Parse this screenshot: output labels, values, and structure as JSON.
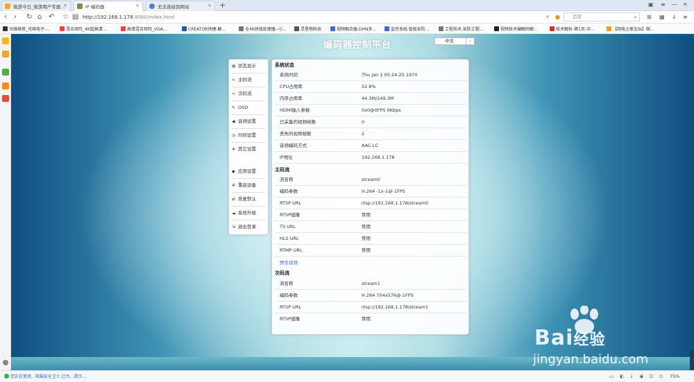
{
  "browser": {
    "tabs": [
      {
        "label": "微游今日_微游用户专属..."
      },
      {
        "label": "IP 编码器"
      },
      {
        "label": "无法连接到网站"
      }
    ],
    "new_tab": "+",
    "url_host": "http://192.168.1.178",
    "url_path": ":8080/index.html",
    "search_placeholder": "百度",
    "zoom": "75%",
    "bookmarks": [
      {
        "label": "讯维维修_讯维电子-..."
      },
      {
        "label": "混合矩阵_4K超高清..."
      },
      {
        "label": "高清混合矩阵_VGA..."
      },
      {
        "label": "CREATOR快捷-解..."
      },
      {
        "label": "全4K拼接处理器--小..."
      },
      {
        "label": "灵星雨科技"
      },
      {
        "label": "视频融合器,DHN多..."
      },
      {
        "label": "监控系统,智能安防..."
      },
      {
        "label": "工程技术,安防工程..."
      },
      {
        "label": "视频技术编解码解..."
      },
      {
        "label": "技术解析-第1页-中..."
      },
      {
        "label": "【网电之家论坛】图..."
      }
    ],
    "status_message": "您正在使用...电脑安全卫士:已为...提示..."
  },
  "app": {
    "title": "编码器控制平台",
    "language": "中文"
  },
  "sidebar": {
    "items": [
      {
        "label": "状态显示",
        "icon": "doc-icon"
      },
      {
        "label": "主码流",
        "icon": "share-icon"
      },
      {
        "label": "次码流",
        "icon": "share-icon"
      },
      {
        "label": "OSD",
        "icon": "pencil-icon"
      },
      {
        "label": "音频设置",
        "icon": "volume-icon"
      },
      {
        "label": "时间设置",
        "icon": "clock-icon"
      },
      {
        "label": "其它设置",
        "icon": "gear-icon"
      },
      {
        "label": "应用设置",
        "icon": "app-icon"
      },
      {
        "label": "重启设备",
        "icon": "gear-icon"
      },
      {
        "label": "恢复默认",
        "icon": "shuffle-icon"
      },
      {
        "label": "系统升级",
        "icon": "cloud-icon"
      },
      {
        "label": "退出登录",
        "icon": "logout-icon"
      }
    ]
  },
  "status": {
    "system_heading": "系统状态",
    "system_rows": [
      {
        "key": "系统时间",
        "value": "Thu Jan 1 05:24:25 1970"
      },
      {
        "key": "CPU占用率",
        "value": "52.8%"
      },
      {
        "key": "内存占用率",
        "value": "44.3M/249.3M"
      },
      {
        "key": "HDMI输入参数",
        "value": "0x0@0FPS 0Kbps"
      },
      {
        "key": "已采集的视频帧数",
        "value": "0"
      },
      {
        "key": "丢失的视频帧数",
        "value": "2"
      },
      {
        "key": "音频编码方式",
        "value": "AAC-LC"
      },
      {
        "key": "IP地址",
        "value": "192.168.1.178"
      }
    ],
    "main_heading": "主码流",
    "main_rows": [
      {
        "key": "流名称",
        "value": "stream0"
      },
      {
        "key": "编码参数",
        "value": "H.264 -1x-1@-1FPS"
      },
      {
        "key": "RTSP URL",
        "value": "rtsp://192.168.1.178/stream0"
      },
      {
        "key": "RTSP组播",
        "value": "禁用"
      },
      {
        "key": "TS URL",
        "value": "禁用"
      },
      {
        "key": "HLS URL",
        "value": "禁用"
      },
      {
        "key": "RTMP URL",
        "value": "禁用"
      }
    ],
    "preview_link": "预览视频",
    "sub_heading": "次码流",
    "sub_rows": [
      {
        "key": "流名称",
        "value": "stream1"
      },
      {
        "key": "编码参数",
        "value": "H.264 704x576@-1FPS"
      },
      {
        "key": "RTSP URL",
        "value": "rtsp://192.168.1.178/stream1"
      },
      {
        "key": "RTSP组播",
        "value": "禁用"
      }
    ]
  },
  "watermark": {
    "brand": "Bai",
    "brand_cn": "经验",
    "url": "jingyan.baidu.com"
  },
  "colors": {
    "link": "#3a6fd8",
    "bg_dark": "#0f4f80",
    "bg_light": "#cdeef0"
  }
}
